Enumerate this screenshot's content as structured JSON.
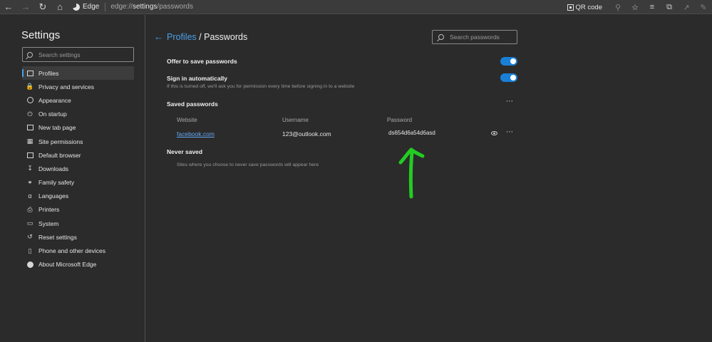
{
  "browser": {
    "badge": "Edge",
    "url_prefix": "edge://",
    "url_host": "settings",
    "url_path": "/passwords",
    "qr_label": "QR code"
  },
  "sidebar": {
    "title": "Settings",
    "search_placeholder": "Search settings",
    "items": [
      {
        "label": "Profiles",
        "icon": "profile-icon",
        "active": true
      },
      {
        "label": "Privacy and services",
        "icon": "lock-icon"
      },
      {
        "label": "Appearance",
        "icon": "palette-icon"
      },
      {
        "label": "On startup",
        "icon": "power-icon"
      },
      {
        "label": "New tab page",
        "icon": "grid-icon"
      },
      {
        "label": "Site permissions",
        "icon": "site-permissions-icon"
      },
      {
        "label": "Default browser",
        "icon": "browser-icon"
      },
      {
        "label": "Downloads",
        "icon": "download-icon"
      },
      {
        "label": "Family safety",
        "icon": "family-icon"
      },
      {
        "label": "Languages",
        "icon": "languages-icon"
      },
      {
        "label": "Printers",
        "icon": "printer-icon"
      },
      {
        "label": "System",
        "icon": "laptop-icon"
      },
      {
        "label": "Reset settings",
        "icon": "reset-icon"
      },
      {
        "label": "Phone and other devices",
        "icon": "phone-icon"
      },
      {
        "label": "About Microsoft Edge",
        "icon": "edge-icon"
      }
    ]
  },
  "main": {
    "breadcrumb_parent": "Profiles",
    "breadcrumb_sep": " / ",
    "breadcrumb_current": "Passwords",
    "search_placeholder": "Search passwords",
    "offer_label": "Offer to save passwords",
    "signin_label": "Sign in automatically",
    "signin_hint": "If this is turned off, we'll ask you for permission every time before signing in to a website",
    "saved_heading": "Saved passwords",
    "columns": {
      "website": "Website",
      "username": "Username",
      "password": "Password"
    },
    "entry": {
      "website": "facebook.com",
      "username": "123@outlook.com",
      "password": "ds654d6a54d6asd"
    },
    "never_heading": "Never saved",
    "never_note": "Sites where you choose to never save passwords will appear here"
  },
  "colors": {
    "accent": "#4aa0e6",
    "toggle_on": "#1a7fd6",
    "annotation": "#22cc22"
  }
}
